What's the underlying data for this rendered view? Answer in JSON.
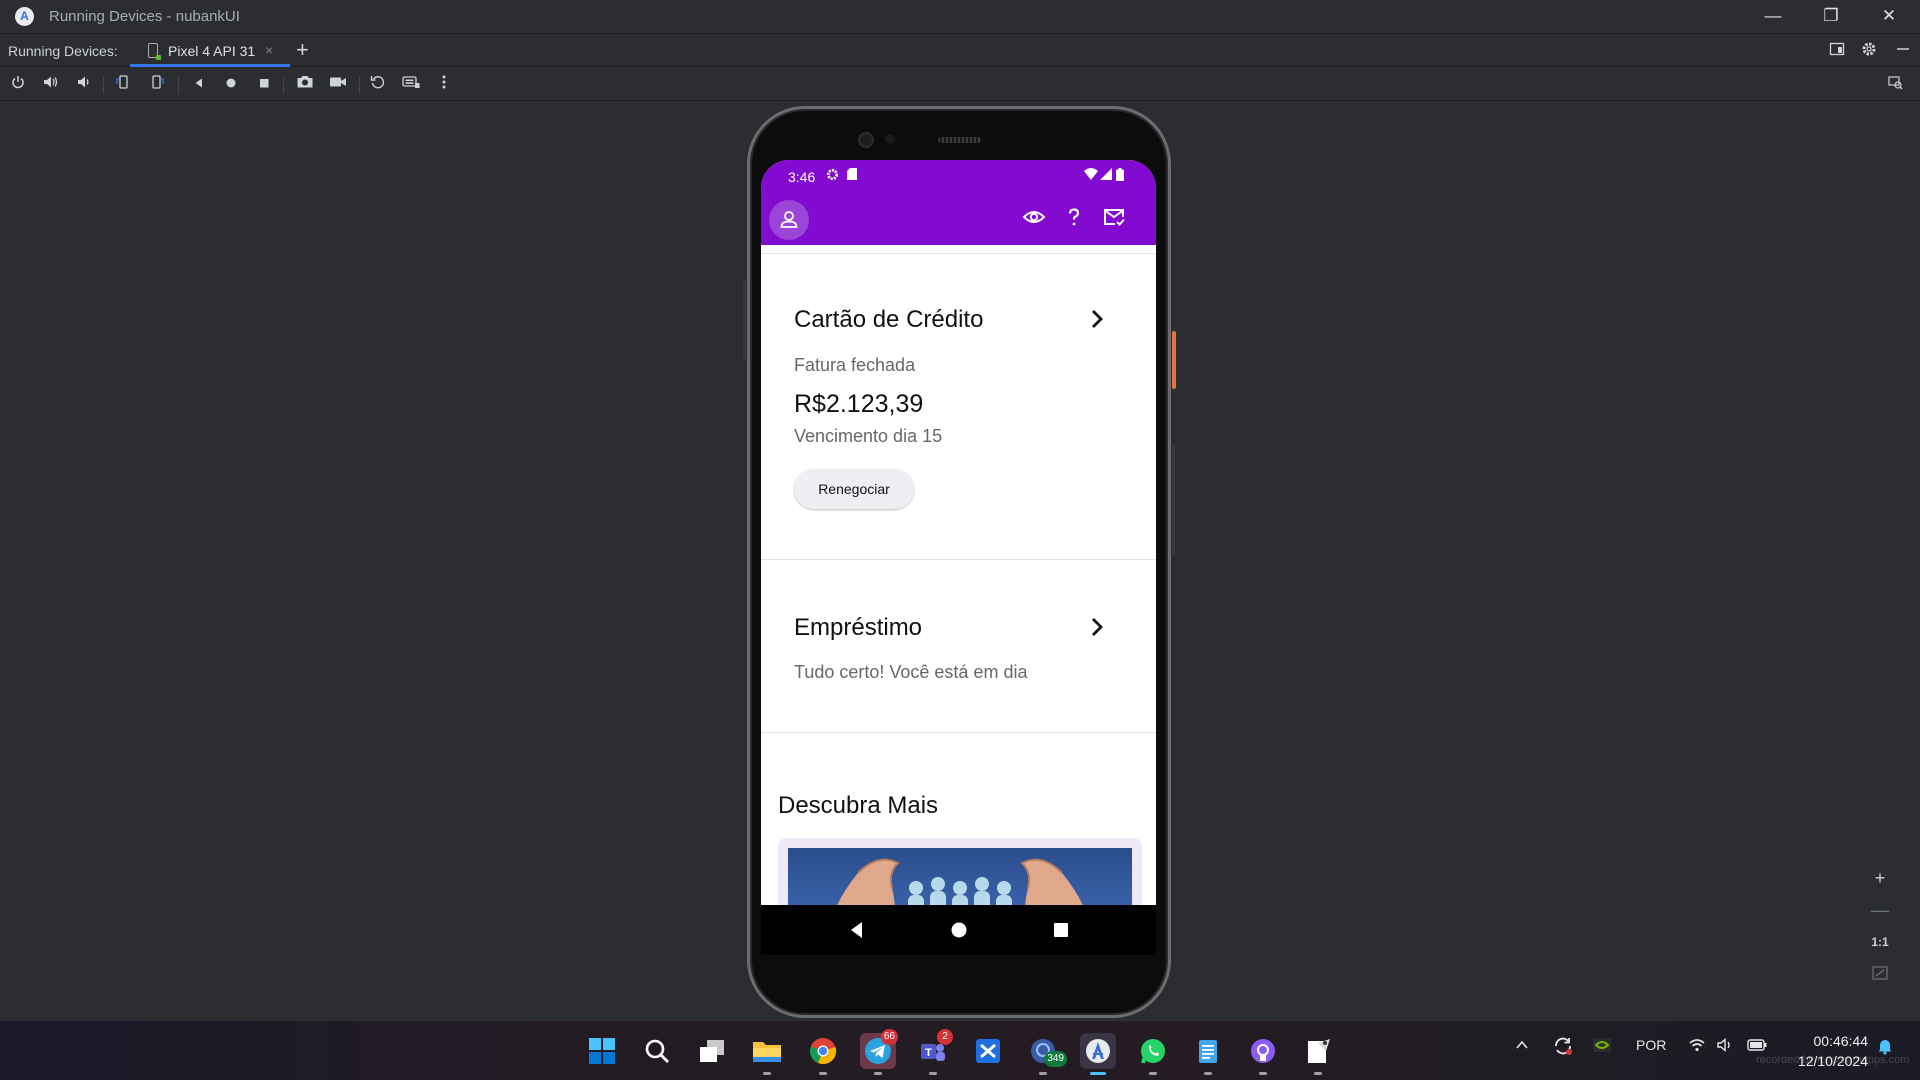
{
  "window": {
    "title": "Running Devices - nubankUI",
    "minimize": "—",
    "restore": "❐",
    "close": "✕"
  },
  "tabbar": {
    "label": "Running Devices:",
    "tab_label": "Pixel 4 API 31",
    "tab_close": "×",
    "add": "+"
  },
  "toolbar": {
    "icons": [
      "power-icon",
      "volume-up-icon",
      "volume-down-icon",
      "rotate-left-icon",
      "rotate-right-icon",
      "back-icon",
      "home-icon",
      "overview-icon",
      "screenshot-icon",
      "record-icon",
      "reset-icon",
      "keyboard-icon",
      "more-icon"
    ]
  },
  "zoom": {
    "plus": "+",
    "minus": "—",
    "actual": "1:1"
  },
  "phone": {
    "status": {
      "time": "3:46"
    },
    "colors": {
      "primary": "#820ad1",
      "avatar": "#9c46d9"
    },
    "cards": [
      {
        "title": "Cartão de Crédito",
        "status": "Fatura fechada",
        "amount": "R$2.123,39",
        "due": "Vencimento dia 15",
        "button": "Renegociar"
      },
      {
        "title": "Empréstimo",
        "status": "Tudo certo! Você está em dia"
      }
    ],
    "discover": {
      "title": "Descubra Mais"
    }
  },
  "taskbar": {
    "telegram_badge": "66",
    "teams_badge": "2",
    "drive_badge": "349",
    "language": "POR",
    "time": "00:46:44",
    "date": "12/10/2024",
    "watermark": "recorded by icecreamapps.com"
  }
}
